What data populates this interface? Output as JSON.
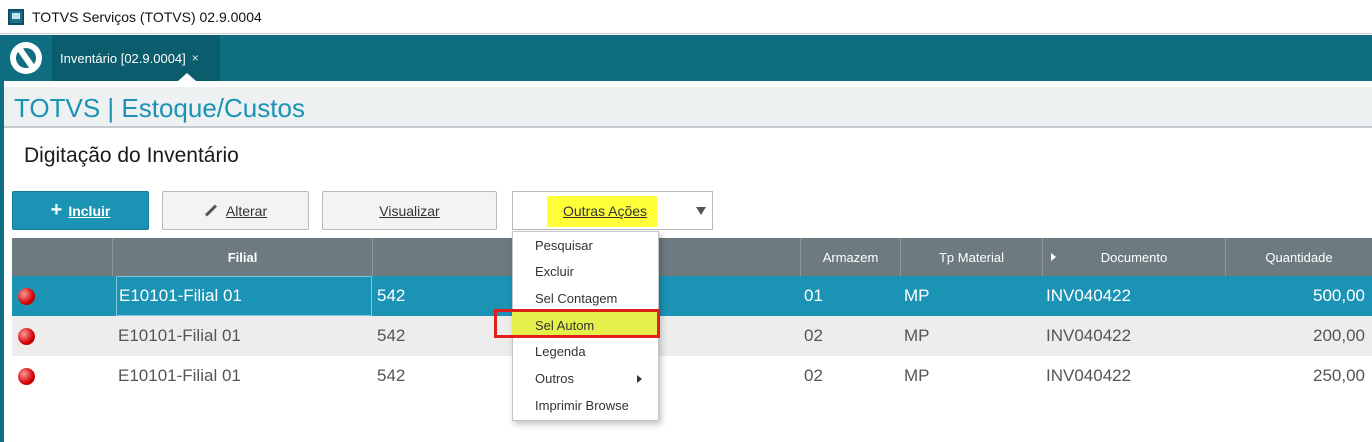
{
  "window": {
    "title": "TOTVS Serviços (TOTVS) 02.9.0004",
    "icon": "app-window-icon"
  },
  "tab": {
    "label": "Inventário [02.9.0004]",
    "close": "×"
  },
  "module": {
    "title": "TOTVS | Estoque/Custos"
  },
  "page": {
    "title": "Digitação do Inventário"
  },
  "toolbar": {
    "incluir": "Incluir",
    "alterar": "Alterar",
    "visualizar": "Visualizar",
    "outras_acoes": "Outras Ações"
  },
  "menu": {
    "items": [
      "Pesquisar",
      "Excluir",
      "Sel Contagem",
      "Sel Autom",
      "Legenda",
      "Outros",
      "Imprimir Browse"
    ],
    "highlighted": "Sel Autom"
  },
  "grid": {
    "columns": [
      "",
      "Filial",
      "",
      "Armazem",
      "Tp Material",
      "Documento",
      "Quantidade"
    ],
    "rows": [
      {
        "filial": "E10101-Filial 01",
        "codigo": "542",
        "armazem": "01",
        "tp": "MP",
        "documento": "INV040422",
        "quantidade": "500,00",
        "status": "red"
      },
      {
        "filial": "E10101-Filial 01",
        "codigo": "542",
        "armazem": "02",
        "tp": "MP",
        "documento": "INV040422",
        "quantidade": "200,00",
        "status": "red"
      },
      {
        "filial": "E10101-Filial 01",
        "codigo": "542",
        "armazem": "02",
        "tp": "MP",
        "documento": "INV040422",
        "quantidade": "250,00",
        "status": "red"
      }
    ]
  },
  "colors": {
    "accent": "#1b93b4",
    "tabbar": "#0f6e81",
    "header": "#6d7a80",
    "highlight": "#ffff3a",
    "annotation": "#e0201b"
  }
}
